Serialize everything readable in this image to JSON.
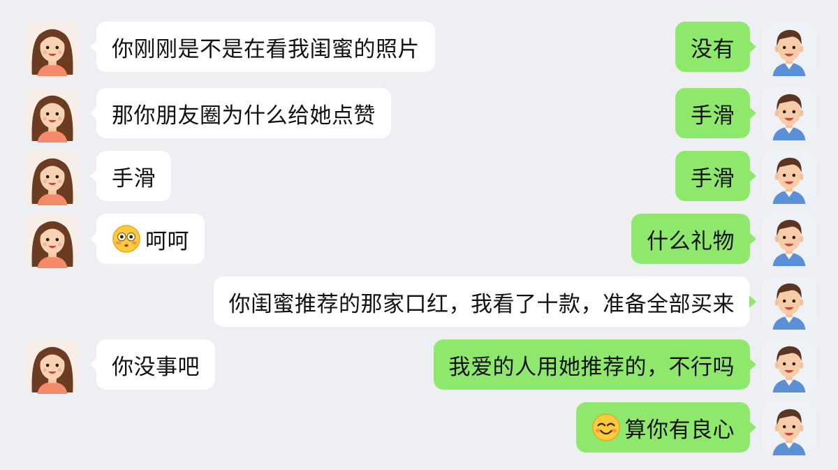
{
  "colors": {
    "background": "#eeeff2",
    "incoming_bubble": "#ffffff",
    "outgoing_bubble": "#8ee86c"
  },
  "messages": [
    {
      "sender": "girl",
      "text": "你刚刚是不是在看我闺蜜的照片"
    },
    {
      "sender": "boy",
      "text": "没有"
    },
    {
      "sender": "girl",
      "text": "那你朋友圈为什么给她点赞"
    },
    {
      "sender": "boy",
      "text": "手滑"
    },
    {
      "sender": "girl",
      "text": "手滑"
    },
    {
      "sender": "boy",
      "text": "手滑"
    },
    {
      "sender": "girl",
      "emoji": "flushed-face-icon",
      "text": "呵呵"
    },
    {
      "sender": "boy",
      "text": "什么礼物"
    },
    {
      "sender": "boy",
      "text": "你闺蜜推荐的那家口红，我看了十款，准备全部买来"
    },
    {
      "sender": "girl",
      "text": "你没事吧"
    },
    {
      "sender": "boy",
      "text": "我爱的人用她推荐的，不行吗"
    },
    {
      "sender": "boy",
      "emoji": "smiling-face-icon",
      "text": "算你有良心"
    }
  ]
}
